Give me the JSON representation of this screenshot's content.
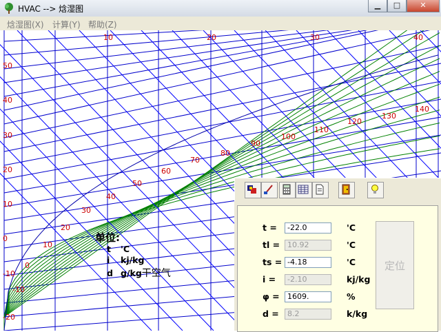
{
  "window": {
    "title": "HVAC --> 焓湿图",
    "controls": [
      "minimize",
      "maximize",
      "close"
    ]
  },
  "menu": {
    "items": [
      "焓湿图(X)",
      "计算(Y)",
      "帮助(Z)"
    ]
  },
  "chart_data": {
    "type": "psychrometric",
    "left_axis_labels": [
      "50",
      "40",
      "30",
      "20",
      "10",
      "0",
      "-10",
      "-20"
    ],
    "top_axis_labels": [
      "10",
      "20",
      "30",
      "40"
    ],
    "enthalpy_labels": [
      "-10",
      "0",
      "10",
      "20",
      "30",
      "40",
      "50",
      "60",
      "70",
      "80",
      "90",
      "100",
      "110",
      "120",
      "130",
      "140"
    ]
  },
  "units": {
    "title": "单位:",
    "rows": [
      {
        "sym": "t",
        "unit": "'C"
      },
      {
        "sym": "i",
        "unit": "kj/kg"
      },
      {
        "sym": "d",
        "unit": "g/kg",
        "suffix": "干空气"
      }
    ]
  },
  "toolbar": {
    "buttons": [
      "psychro-chart-icon",
      "edit-brush-icon",
      "calculator-icon",
      "table-icon",
      "document-icon",
      "exit-door-icon",
      "lightbulb-icon"
    ]
  },
  "fields": [
    {
      "label": "t  =",
      "value": "-22.0",
      "unit": "'C",
      "disabled": false
    },
    {
      "label": "tl  =",
      "value": "10.92",
      "unit": "'C",
      "disabled": true
    },
    {
      "label": "ts  =",
      "value": "-4.18",
      "unit": "'C",
      "disabled": false
    },
    {
      "label": "i   =",
      "value": "-2.10",
      "unit": "kj/kg",
      "disabled": true
    },
    {
      "label": "φ  =",
      "value": "1609.",
      "unit": "%",
      "disabled": false
    },
    {
      "label": "d   =",
      "value": "8.2",
      "unit": "k/kg",
      "disabled": true
    }
  ],
  "locate_button": "定位",
  "colors": {
    "temp_lines": "#0000cc",
    "enthalpy_lines": "#0000ff",
    "humidity_lines": "#008000",
    "grid": "#006400",
    "labels": "#cc0000"
  }
}
